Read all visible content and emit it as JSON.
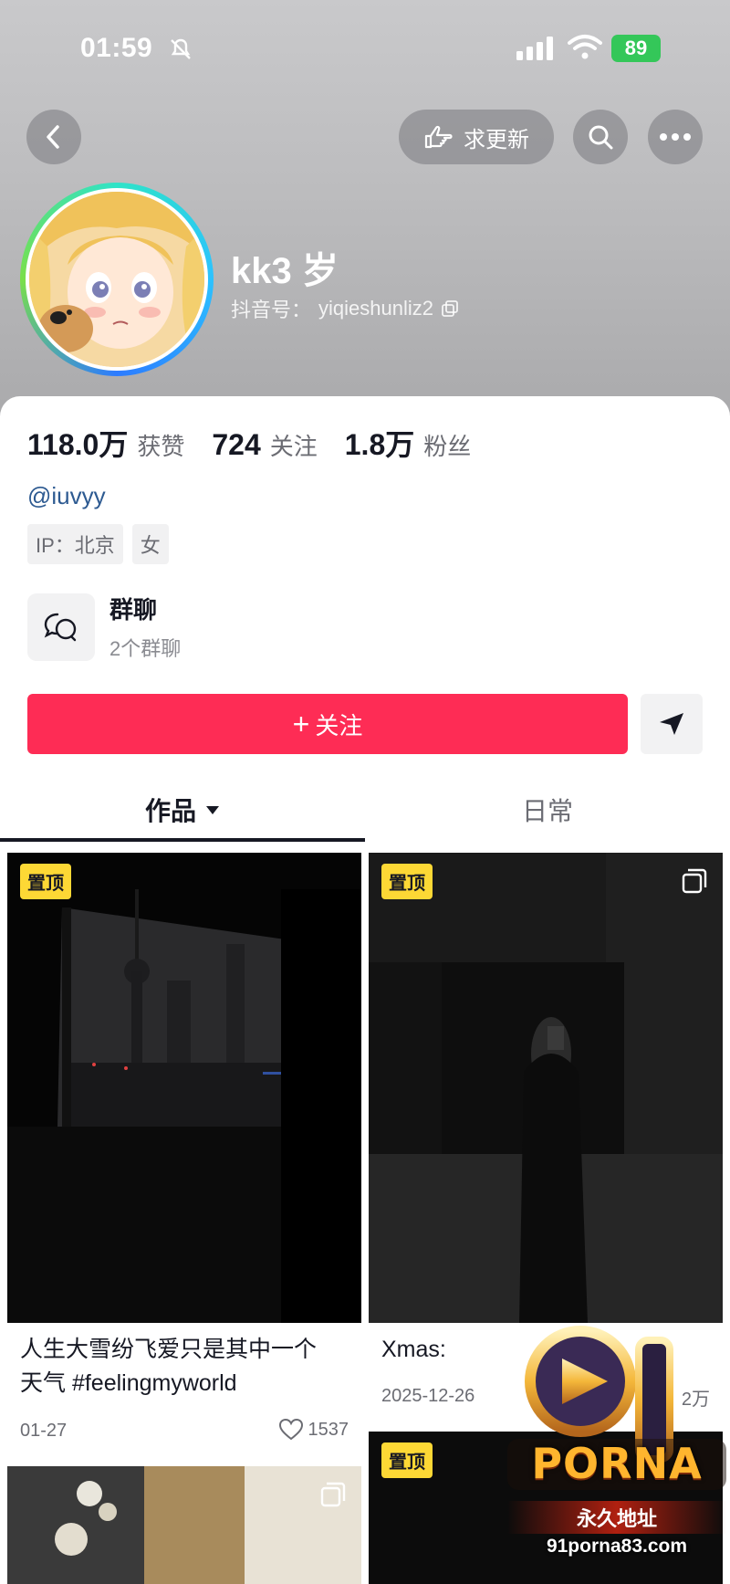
{
  "status_bar": {
    "time": "01:59",
    "battery": "89"
  },
  "header": {
    "update_button_label": "求更新",
    "display_name": "kk3 岁",
    "douyin_id_label": "抖音号：",
    "douyin_id": "yiqieshunliz2"
  },
  "stats": [
    {
      "value": "118.0万",
      "label": "获赞"
    },
    {
      "value": "724",
      "label": "关注"
    },
    {
      "value": "1.8万",
      "label": "粉丝"
    }
  ],
  "bio": {
    "mention": "@iuvyy",
    "tags": [
      "IP：北京",
      "女"
    ]
  },
  "group_chat": {
    "title": "群聊",
    "subtitle": "2个群聊"
  },
  "actions": {
    "follow_label": "关注",
    "follow_prefix": "+"
  },
  "tabs": [
    {
      "label": "作品",
      "active": true
    },
    {
      "label": "日常",
      "active": false
    }
  ],
  "posts": [
    {
      "pinned_label": "置顶",
      "caption_line1": "人生大雪纷飞爱只是其中一个",
      "caption_line2": "天气 #feelingmyworld",
      "date": "01-27",
      "likes": "1537"
    },
    {
      "pinned_label": "置顶",
      "caption_line1": "Xmas:",
      "date": "2025-12-26",
      "likes": "2万"
    },
    {
      "pinned_label": ""
    },
    {
      "pinned_label": "置顶"
    }
  ],
  "watermark": {
    "brand_number": "91",
    "brand_name": "PORNA",
    "subtitle": "永久地址",
    "url": "91porna83.com"
  },
  "colors": {
    "accent": "#fe2c55",
    "pin_badge": "#fdd835",
    "link": "#2d5a91"
  }
}
